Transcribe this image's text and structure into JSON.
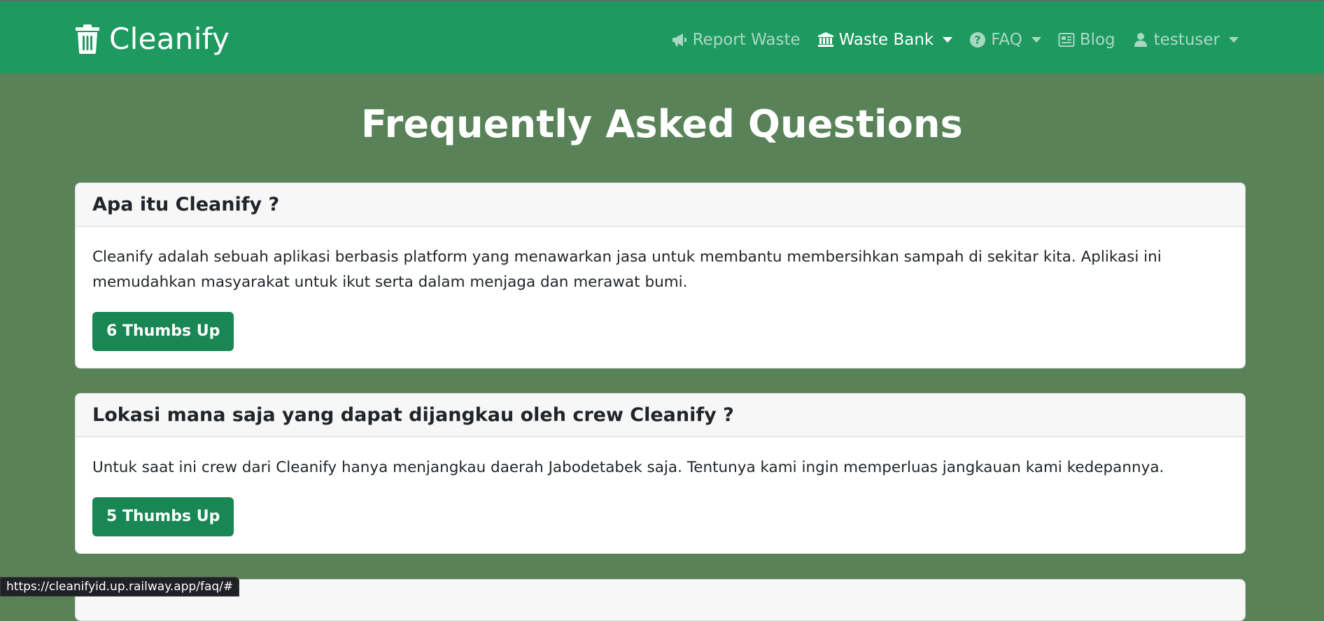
{
  "navbar": {
    "brand": "Cleanify",
    "items": [
      {
        "label": "Report Waste",
        "icon": "megaphone-icon",
        "dropdown": false,
        "active": false
      },
      {
        "label": "Waste Bank",
        "icon": "bank-icon",
        "dropdown": true,
        "active": true
      },
      {
        "label": "FAQ",
        "icon": "question-circle-icon",
        "dropdown": true,
        "active": false
      },
      {
        "label": "Blog",
        "icon": "newspaper-icon",
        "dropdown": false,
        "active": false
      },
      {
        "label": "testuser",
        "icon": "user-icon",
        "dropdown": true,
        "active": false
      }
    ]
  },
  "page": {
    "title": "Frequently Asked Questions"
  },
  "faqs": [
    {
      "question": "Apa itu Cleanify ?",
      "answer": "Cleanify adalah sebuah aplikasi berbasis platform yang menawarkan jasa untuk membantu membersihkan sampah di sekitar kita. Aplikasi ini memudahkan masyarakat untuk ikut serta dalam menjaga dan merawat bumi.",
      "thumbs": "6 Thumbs Up"
    },
    {
      "question": "Lokasi mana saja yang dapat dijangkau oleh crew Cleanify ?",
      "answer": "Untuk saat ini crew dari Cleanify hanya menjangkau daerah Jabodetabek saja. Tentunya kami ingin memperluas jangkauan kami kedepannya.",
      "thumbs": "5 Thumbs Up"
    }
  ],
  "status_bar": {
    "url": "https://cleanifyid.up.railway.app/faq/#"
  },
  "colors": {
    "navbar": "#1e9a60",
    "background": "#5a8259",
    "button": "#198754"
  }
}
